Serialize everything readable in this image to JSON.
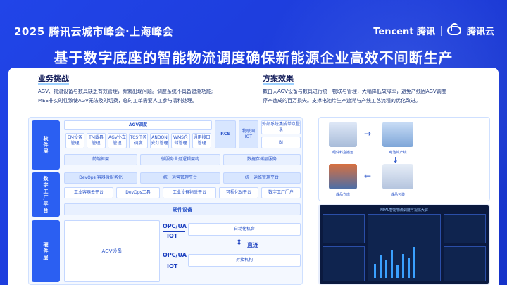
{
  "header": {
    "event_title": "2025 腾讯云城市峰会·上海峰会",
    "brand_tencent": "Tencent 腾讯",
    "brand_cloud": "腾讯云"
  },
  "main_title": "基于数字底座的智能物流调度确保新能源企业高效不间断生产",
  "challenges": {
    "heading": "业务挑战",
    "line1": "AGV、物流设备与数具缺乏有效管理，频繁出现问题。调度系统不具备追溯功能;",
    "line2": "MES非实时性致使AGV无法及时切换，临时工单需要人工参与清料处理。"
  },
  "solution": {
    "heading": "方案效果",
    "line1": "数白天AGV设备与数具进行统一物联与管理，大幅降低故障率，避免产线因AGV调度",
    "line2": "停产造成的百万损失。支撑电池片生产追溯与产线工艺流程的优化改进。"
  },
  "architecture": {
    "software_layer": "软件层",
    "digital_layer": "数字工厂平台",
    "hardware_layer": "硬件层",
    "agv_dispatch": "AGV调度",
    "rcs": "RCS",
    "iot_box": "物联网IOT",
    "external": "外部系统集成单点登录",
    "bi": "BI",
    "sw_modules": [
      "EM设备管理",
      "TM载具管理",
      "AGV小车管理",
      "TCS任务调度",
      "ANDON安灯管理",
      "WMS仓储管理",
      "通用接口管理"
    ],
    "frontend": "前端框架",
    "microservice": "微服务业务逻辑架构",
    "storage": "数据存储层服务",
    "devops_row": [
      "DevOps|容器微服务化",
      "统一运营管理平台",
      "统一运维管理平台"
    ],
    "platform_row": [
      "工业容器云平台",
      "DevOps工具",
      "工业设备物联平台",
      "可视化BI平台",
      "数字工厂门户"
    ],
    "hardware_devices": "硬件设备",
    "agv_device": "AGV设备",
    "opc_ua_1": "OPC/UA",
    "iot_1": "IOT",
    "opc_ua_2": "OPC/UA",
    "iot_2": "IOT",
    "auto_machine": "自动化机台",
    "direct": "直连",
    "docking": "对接机构"
  },
  "flow": {
    "captions": [
      "组件料盒搬运",
      "电池片产线",
      "成品立库",
      "成品包装"
    ]
  },
  "dashboard": {
    "title": "NPAL智能物流调度可视化大屏"
  },
  "colors": {
    "background": "#1f3fe0",
    "accent": "#2b5ff2",
    "panel": "#ffffff"
  }
}
